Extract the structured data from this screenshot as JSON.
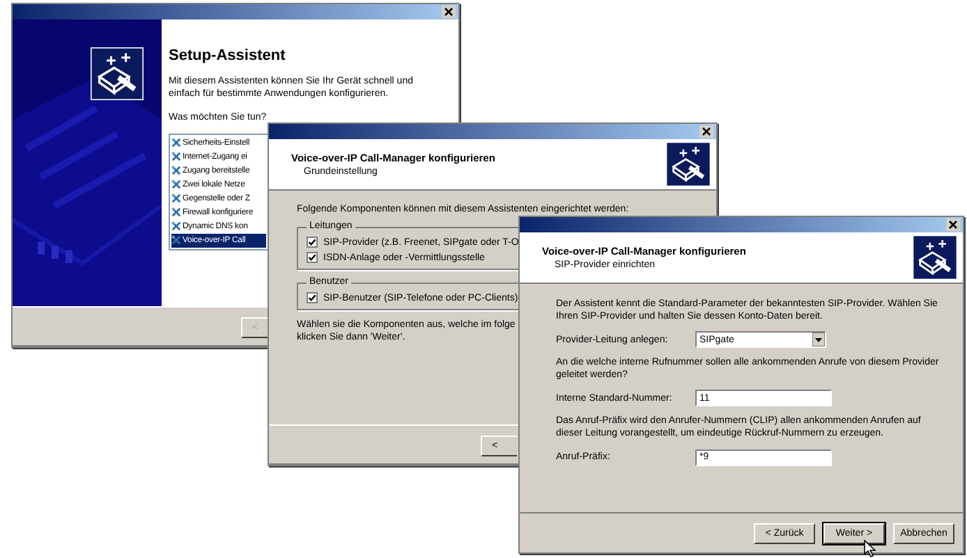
{
  "windows": [
    {
      "kind": "setup",
      "title": "Setup-Assistent",
      "intro": "Mit diesem Assistenten können Sie Ihr Gerät schnell und einfach für bestimmte Anwendungen konfigurieren.",
      "question": "Was möchten Sie tun?",
      "options": [
        {
          "label": "Sicherheits-Einstell",
          "selected": false
        },
        {
          "label": "Internet-Zugang ei",
          "selected": false
        },
        {
          "label": "Zugang bereitstelle",
          "selected": false
        },
        {
          "label": "Zwei lokale Netze",
          "selected": false
        },
        {
          "label": "Gegenstelle oder Z",
          "selected": false
        },
        {
          "label": "Firewall konfiguriere",
          "selected": false
        },
        {
          "label": "Dynamic DNS kon",
          "selected": false
        },
        {
          "label": "Voice-over-IP Call",
          "selected": true
        }
      ],
      "back_button": {
        "label": "<",
        "disabled": true
      }
    },
    {
      "kind": "components",
      "title": "Voice-over-IP Call-Manager konfigurieren",
      "subtitle": "Grundeinstellung",
      "intro": "Folgende Komponenten können mit diesem Assistenten eingerichtet werden:",
      "groups": [
        {
          "title": "Leitungen",
          "options": [
            {
              "label": "SIP-Provider (z.B. Freenet, SIPgate oder T-O",
              "checked": true
            },
            {
              "label": "ISDN-Anlage oder -Vermittlungsstelle",
              "checked": true
            }
          ]
        },
        {
          "title": "Benutzer",
          "options": [
            {
              "label": "SIP-Benutzer (SIP-Telefone oder PC-Clients)",
              "checked": true
            }
          ]
        }
      ],
      "hint": "Wählen sie die Komponenten aus, welche im folge\nklicken Sie dann 'Weiter'.",
      "back_button": {
        "label": "<",
        "disabled": false
      }
    },
    {
      "kind": "provider",
      "title": "Voice-over-IP Call-Manager konfigurieren",
      "subtitle": "SIP-Provider einrichten",
      "intro": "Der Assistent kennt die Standard-Parameter der bekanntesten SIP-Provider. Wählen Sie Ihren SIP-Provider und halten Sie dessen Konto-Daten bereit.",
      "provider": {
        "label": "Provider-Leitung anlegen:",
        "value": "SIPgate"
      },
      "question": "An die welche interne Rufnummer sollen alle ankommenden Anrufe von diesem Provider geleitet werden?",
      "number": {
        "label": "Interne Standard-Nummer:",
        "value": "11"
      },
      "prefix_info": "Das Anruf-Präfix wird den Anrufer-Nummern (CLIP) allen ankommenden Anrufen auf dieser Leitung vorangestellt, um eindeutige Rückruf-Nummern zu erzeugen.",
      "prefix": {
        "label": "Anruf-Präfix:",
        "value": "*9"
      },
      "buttons": [
        {
          "label": "< Zurück",
          "focused": false
        },
        {
          "label": "Weiter >",
          "focused": true
        },
        {
          "label": "Abbrechen",
          "focused": false
        }
      ]
    }
  ]
}
